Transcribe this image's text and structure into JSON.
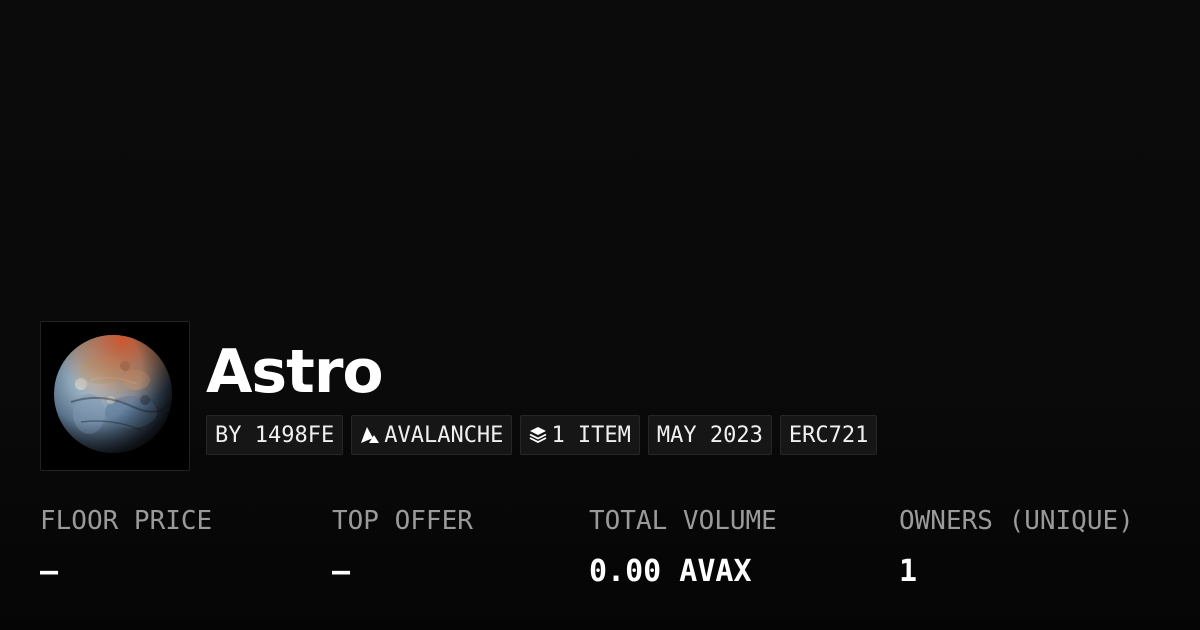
{
  "collection": {
    "name": "Astro",
    "image_alt": "planet-image"
  },
  "badges": [
    {
      "text": "BY 1498FE",
      "icon": ""
    },
    {
      "text": "AVALANCHE",
      "icon": "avalanche-icon"
    },
    {
      "text": "1 ITEM",
      "icon": "layers-icon"
    },
    {
      "text": "MAY 2023",
      "icon": ""
    },
    {
      "text": "ERC721",
      "icon": ""
    }
  ],
  "stats": [
    {
      "label": "FLOOR PRICE",
      "value": "—"
    },
    {
      "label": "TOP OFFER",
      "value": "—"
    },
    {
      "label": "TOTAL VOLUME",
      "value": "0.00 AVAX"
    },
    {
      "label": "OWNERS (UNIQUE)",
      "value": "1"
    }
  ],
  "colors": {
    "background": "#0a0a0a",
    "badge_bg": "#161616",
    "label": "#9a9a9a",
    "text": "#ffffff"
  }
}
